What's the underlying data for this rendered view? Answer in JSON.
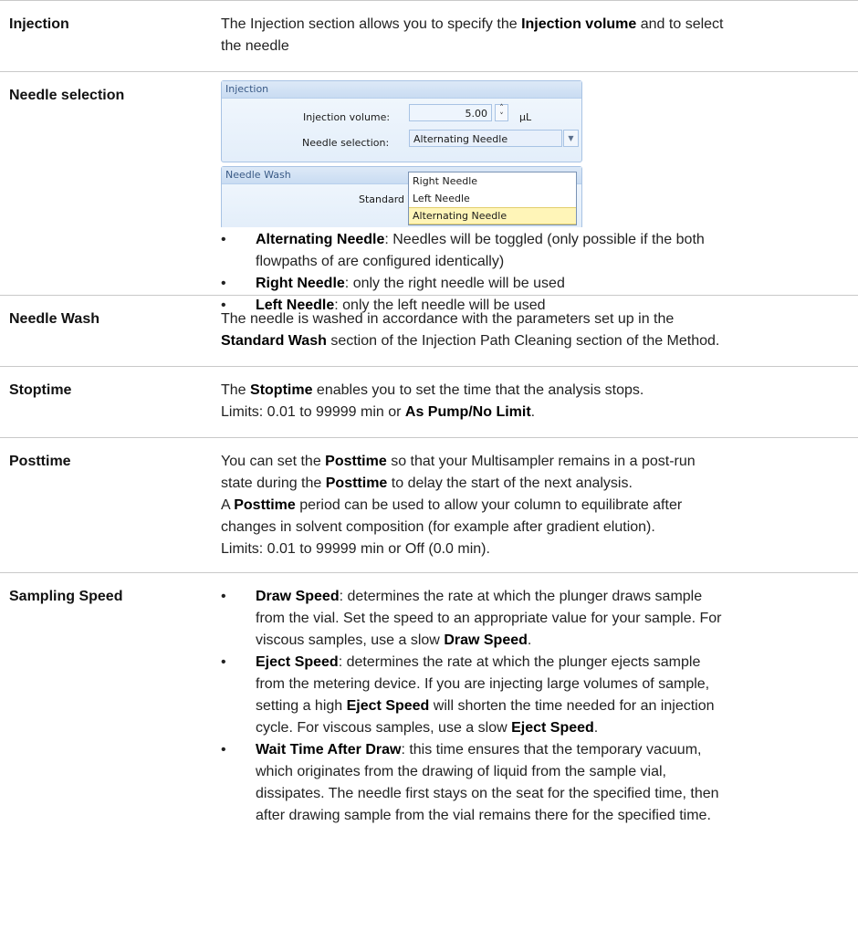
{
  "rows": {
    "injection": {
      "term": "Injection",
      "l1_a": "The Injection section allows you to specify the ",
      "l1_b": "Injection volume",
      "l1_c": " and to select",
      "l2": "the needle"
    },
    "needle_selection": {
      "term": "Needle selection",
      "screenshot": {
        "group_title": "Injection",
        "volume_label": "Injection volume:",
        "volume_value": "5.00",
        "volume_unit": "µL",
        "spin_up": "˄",
        "spin_down": "˅",
        "needle_label": "Needle selection:",
        "needle_value": "Alternating Needle",
        "dropdown_arrow": "▼",
        "options": [
          "Right Needle",
          "Left Needle",
          "Alternating Needle"
        ],
        "wash_title": "Needle Wash",
        "wash_value": "Standard Wash"
      },
      "bullet": "•",
      "b1_term": "Alternating Needle",
      "b1_l1": ": Needles will be toggled (only possible if the both",
      "b1_l2": "flowpaths of are configured identically)",
      "b2_term": "Right Needle",
      "b2_rest": ": only the right needle will be used",
      "b3_term": "Left Needle",
      "b3_rest": ": only the left needle will be used"
    },
    "needle_wash": {
      "term": "Needle Wash",
      "l1": "The needle is washed in accordance with the parameters set up in the",
      "l2_b": "Standard Wash",
      "l2_rest": " section of the Injection Path Cleaning section of the Method."
    },
    "stoptime": {
      "term": "Stoptime",
      "l1_a": "The ",
      "l1_b": "Stoptime",
      "l1_c": " enables you to set the time that the analysis stops.",
      "l2_a": "Limits: 0.01 to 99999 min or ",
      "l2_b": "As Pump/No Limit",
      "l2_c": "."
    },
    "posttime": {
      "term": "Posttime",
      "l1_a": "You can set the ",
      "l1_b": "Posttime",
      "l1_c": " so that your Multisampler remains in a post-run",
      "l2_a": "state during the ",
      "l2_b": "Posttime",
      "l2_c": " to delay the start of the next analysis.",
      "l3_a": "A ",
      "l3_b": "Posttime",
      "l3_c": " period can be used to allow your column to equilibrate after",
      "l4": "changes in solvent composition (for example after gradient elution).",
      "l5": "Limits: 0.01 to 99999 min or Off (0.0 min)."
    },
    "sampling_speed": {
      "term": "Sampling Speed",
      "bullet": "•",
      "d_term": "Draw Speed",
      "d_l1": ": determines the rate at which the plunger draws sample",
      "d_l2": "from the vial. Set the speed to an appropriate value for your sample. For",
      "d_l3_a": "viscous samples, use a slow ",
      "d_l3_b": "Draw Speed",
      "d_l3_c": ".",
      "e_term": "Eject Speed",
      "e_l1": ": determines the rate at which the plunger ejects sample",
      "e_l2": "from the metering device. If you are injecting large volumes of sample,",
      "e_l3_a": "setting a high ",
      "e_l3_b": "Eject Speed",
      "e_l3_c": " will shorten the time needed for an injection",
      "e_l4_a": "cycle. For viscous samples, use a slow ",
      "e_l4_b": "Eject Speed",
      "e_l4_c": ".",
      "w_term": "Wait Time After Draw",
      "w_l1": ": this time ensures that the temporary vacuum,",
      "w_l2": "which originates from the drawing of liquid from the sample vial,",
      "w_l3": "dissipates. The needle first stays on the seat for the specified time, then",
      "w_l4": "after drawing sample from the vial remains there for the specified time."
    }
  }
}
